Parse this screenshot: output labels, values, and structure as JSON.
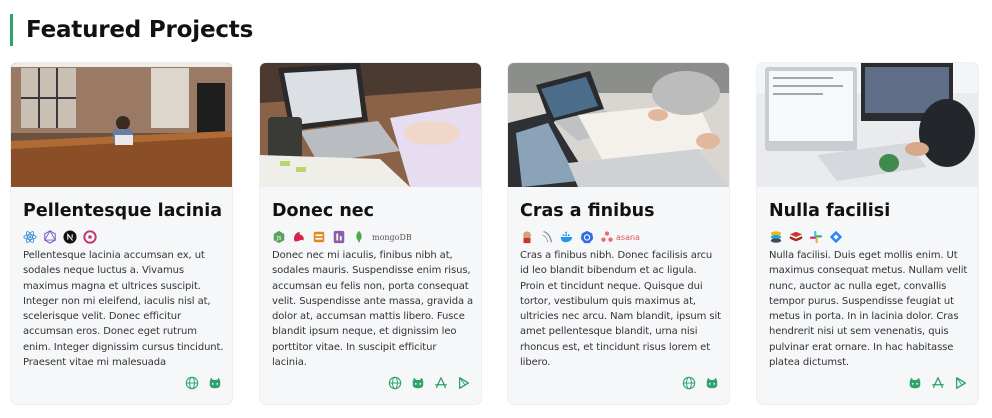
{
  "section": {
    "title": "Featured Projects"
  },
  "projects": [
    {
      "title": "Pellentesque lacinia",
      "description": "Pellentesque lacinia accumsan ex, ut sodales neque luctus a. Vivamus maximus magna et ultrices suscipit. Integer non mi eleifend, iaculis nisl at, scelerisque velit. Donec efficitur accumsan eros. Donec eget rutrum enim. Integer dignissim cursus tincidunt. Praesent vitae mi malesuada",
      "image": "office-laptop-photo",
      "tech": [
        "react-icon",
        "graphql-icon",
        "nextjs-icon",
        "redux-icon"
      ],
      "links": [
        "globe-icon",
        "github-icon"
      ]
    },
    {
      "title": "Donec nec",
      "description": "Donec nec mi iaculis, finibus nibh at, sodales mauris. Suspendisse enim risus, accumsan eu felis non, porta consequat velit. Suspendisse ante massa, gravida a dolor at, accumsan mattis libero. Fusce blandit ipsum neque, et dignissim leo porttitor vitae. In suscipit efficitur lacinia.",
      "image": "laptop-typing-photo",
      "tech": [
        "nodejs-icon",
        "nestjs-icon",
        "aws-icon",
        "heroku-icon"
      ],
      "tech_text": "mongoDB",
      "links": [
        "globe-icon",
        "github-icon",
        "app-store-icon",
        "play-store-icon"
      ]
    },
    {
      "title": "Cras a finibus",
      "description": "Cras a finibus nibh. Donec facilisis arcu id leo blandit bibendum et ac ligula. Proin et tincidunt neque. Quisque dui tortor, vestibulum quis maximus at, ultricies nec arcu. Nam blandit, ipsum sit amet pellentesque blandit, urna nisi rhoncus est, et tincidunt risus lorem et libero.",
      "image": "meeting-laptops-photo",
      "tech": [
        "jenkins-icon",
        "elasticsearch-icon",
        "docker-icon",
        "kubernetes-icon"
      ],
      "tech_text": "asana",
      "links": [
        "globe-icon",
        "github-icon"
      ]
    },
    {
      "title": "Nulla facilisi",
      "description": "Nulla facilisi. Duis eget mollis enim. Ut maximus consequat metus. Nullam velit nunc, auctor ac nulla eget, convallis tempor purus. Suspendisse feugiat ut metus in porta. In in lacinia dolor. Cras hendrerit nisi ut sem venenatis, quis pulvinar erat ornare. In hac habitasse platea dictumst.",
      "image": "desk-monitors-photo",
      "tech": [
        "stack-icon",
        "redis-icon",
        "slack-icon",
        "jira-icon"
      ],
      "links": [
        "github-icon",
        "app-store-icon",
        "play-store-icon"
      ]
    }
  ]
}
